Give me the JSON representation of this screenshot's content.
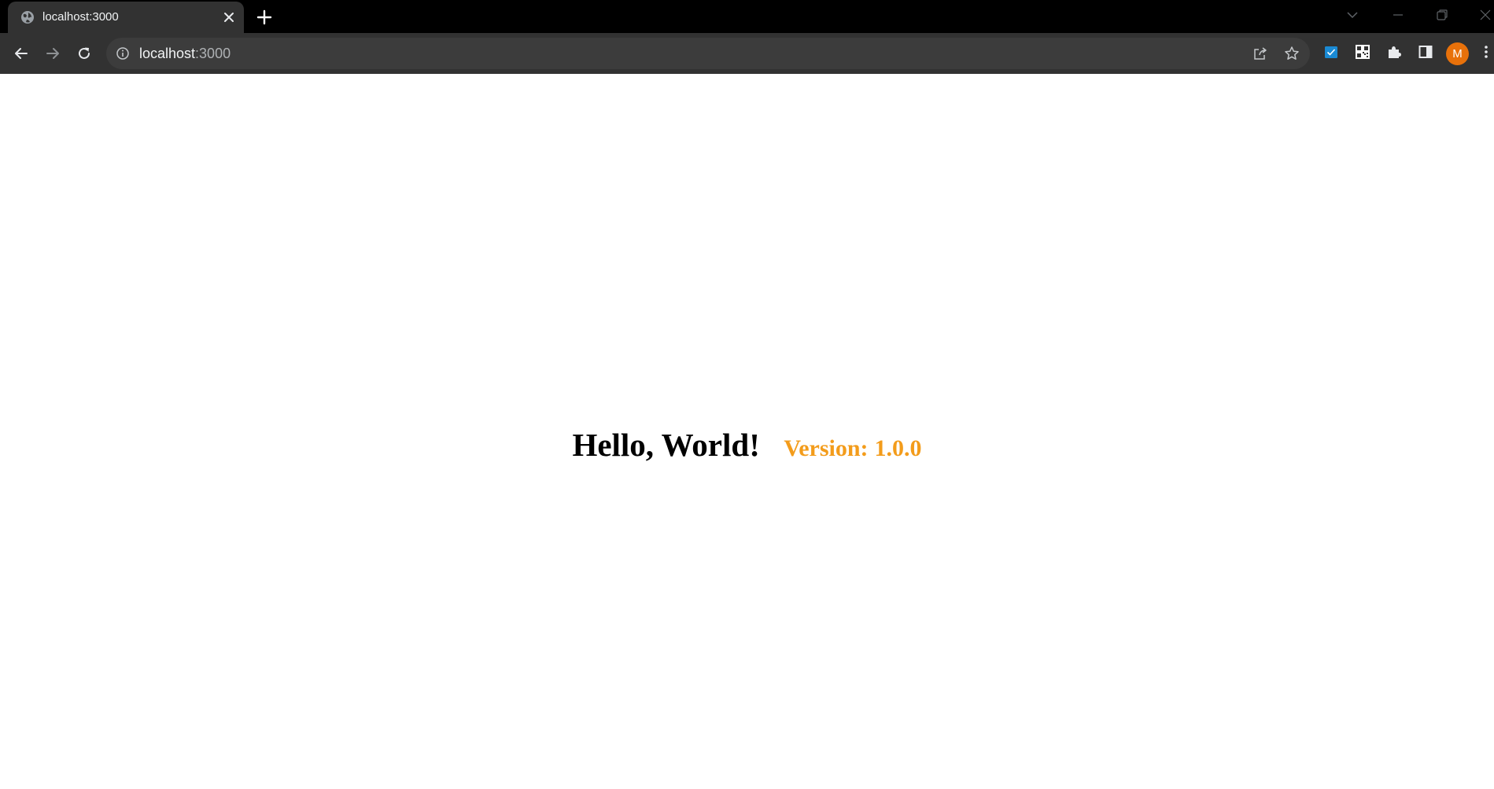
{
  "browser": {
    "tab": {
      "title": "localhost:3000",
      "favicon": "globe-icon",
      "close_icon": "close-icon"
    },
    "new_tab_icon": "plus-icon",
    "window_controls": [
      "tab-search-icon",
      "minimize-icon",
      "restore-icon",
      "close-icon"
    ],
    "toolbar": {
      "back_icon": "arrow-left-icon",
      "forward_icon": "arrow-right-icon",
      "reload_icon": "reload-icon",
      "address": {
        "info_icon": "info-icon",
        "host": "localhost",
        "port": ":3000",
        "share_icon": "share-icon",
        "bookmark_icon": "star-icon"
      },
      "extensions": [
        "checkbox-extension-icon",
        "qr-code-icon",
        "puzzle-icon",
        "side-panel-icon"
      ],
      "profile_initial": "M",
      "menu_icon": "kebab-menu-icon"
    }
  },
  "page": {
    "heading": "Hello, World!",
    "version_label": "Version:",
    "version_value": "1.0.0"
  },
  "colors": {
    "tabstrip_bg": "#000000",
    "toolbar_bg": "#323232",
    "omnibox_bg": "#3c3c3c",
    "avatar_bg": "#e8710a",
    "extension_accent": "#1a8ad4",
    "version_color": "#f39c1b",
    "heading_color": "#000000"
  }
}
